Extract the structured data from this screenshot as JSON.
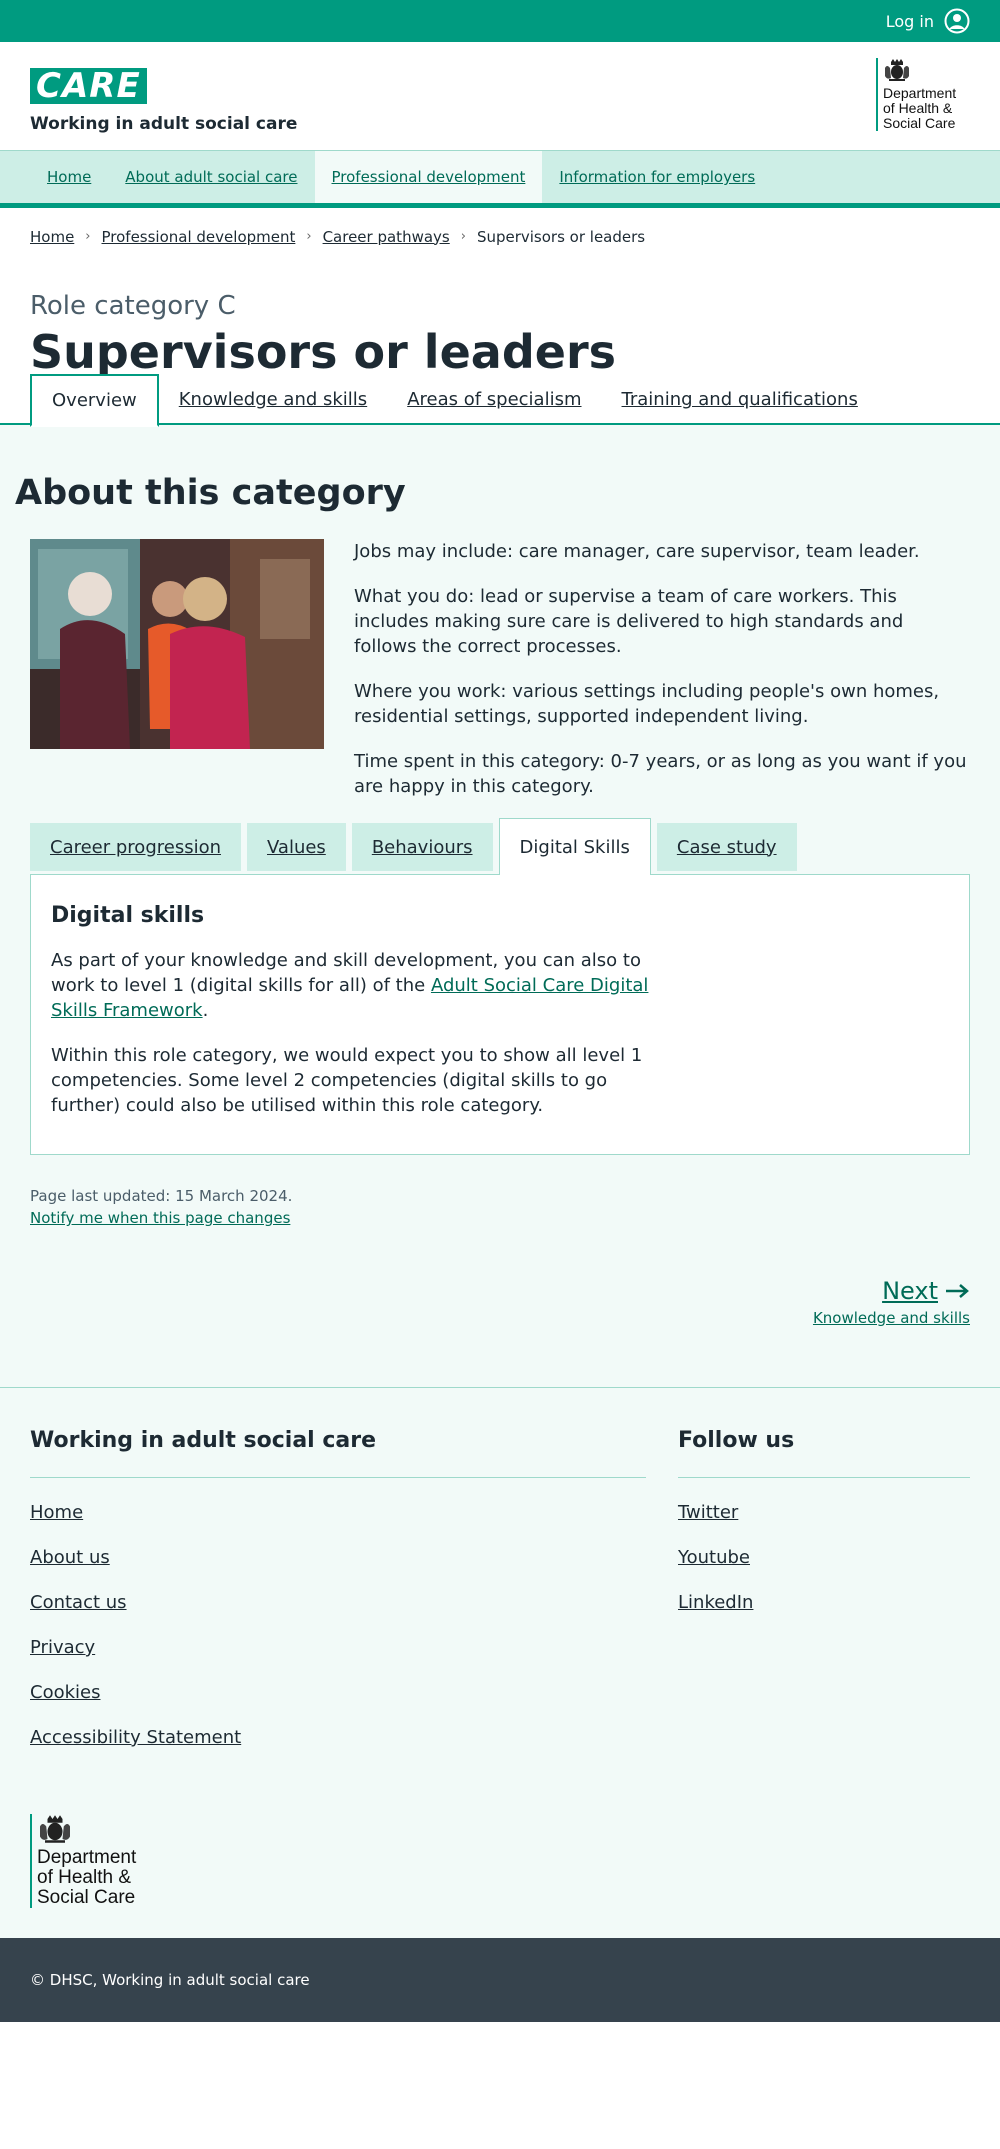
{
  "topbar": {
    "login_label": "Log in",
    "icon": "user-icon"
  },
  "header": {
    "logo_text": "CARE",
    "tagline": "Working in adult social care",
    "dept_line1": "Department",
    "dept_line2": "of Health &",
    "dept_line3": "Social Care"
  },
  "nav": {
    "items": [
      {
        "label": "Home"
      },
      {
        "label": "About adult social care"
      },
      {
        "label": "Professional development"
      },
      {
        "label": "Information for employers"
      }
    ],
    "active_index": 2
  },
  "breadcrumb": {
    "items": [
      {
        "label": "Home"
      },
      {
        "label": "Professional development"
      },
      {
        "label": "Career pathways"
      },
      {
        "label": "Supervisors or leaders"
      }
    ]
  },
  "page": {
    "role_category": "Role category C",
    "title": "Supervisors or leaders"
  },
  "subtabs": {
    "items": [
      {
        "label": "Overview"
      },
      {
        "label": "Knowledge and skills"
      },
      {
        "label": "Areas of specialism"
      },
      {
        "label": "Training and qualifications"
      }
    ],
    "active_index": 0
  },
  "about": {
    "heading": "About this category",
    "paragraphs": [
      "Jobs may include: care manager, care supervisor, team leader.",
      "What you do: lead or supervise a team of care workers. This includes making sure care is delivered to high standards and follows the correct processes.",
      "Where you work: various settings including people's own homes, residential settings, supported independent living.",
      "Time spent in this category: 0-7 years, or as long as you want if you are happy in this category."
    ]
  },
  "tabs": {
    "items": [
      {
        "label": "Career progression"
      },
      {
        "label": "Values"
      },
      {
        "label": "Behaviours"
      },
      {
        "label": "Digital Skills"
      },
      {
        "label": "Case study"
      }
    ],
    "active_index": 3
  },
  "panel": {
    "heading": "Digital skills",
    "p1_before": "As part of your knowledge and skill development, you can also to work to level 1 (digital skills for all) of the ",
    "p1_link": "Adult Social Care Digital Skills Framework",
    "p1_after": ".",
    "p2": "Within this role category, we would expect you to show all level 1 competencies. Some level 2 competencies (digital skills to go further) could also be utilised within this role category."
  },
  "meta": {
    "updated": "Page last updated: 15 March 2024.",
    "notify": "Notify me when this page changes"
  },
  "next": {
    "label": "Next",
    "sub": "Knowledge and skills"
  },
  "footer": {
    "left_heading": "Working in adult social care",
    "left_links": [
      {
        "label": "Home"
      },
      {
        "label": "About us"
      },
      {
        "label": "Contact us"
      },
      {
        "label": "Privacy"
      },
      {
        "label": "Cookies"
      },
      {
        "label": "Accessibility Statement"
      }
    ],
    "right_heading": "Follow us",
    "right_links": [
      {
        "label": "Twitter"
      },
      {
        "label": "Youtube"
      },
      {
        "label": "LinkedIn"
      }
    ],
    "copyright": "© DHSC, Working in adult social care"
  },
  "colors": {
    "brand_green": "#009b80",
    "link_green": "#006b57",
    "nav_bg": "#cdeee6",
    "page_tint": "#f2faf8",
    "footer_dark": "#36434d"
  }
}
